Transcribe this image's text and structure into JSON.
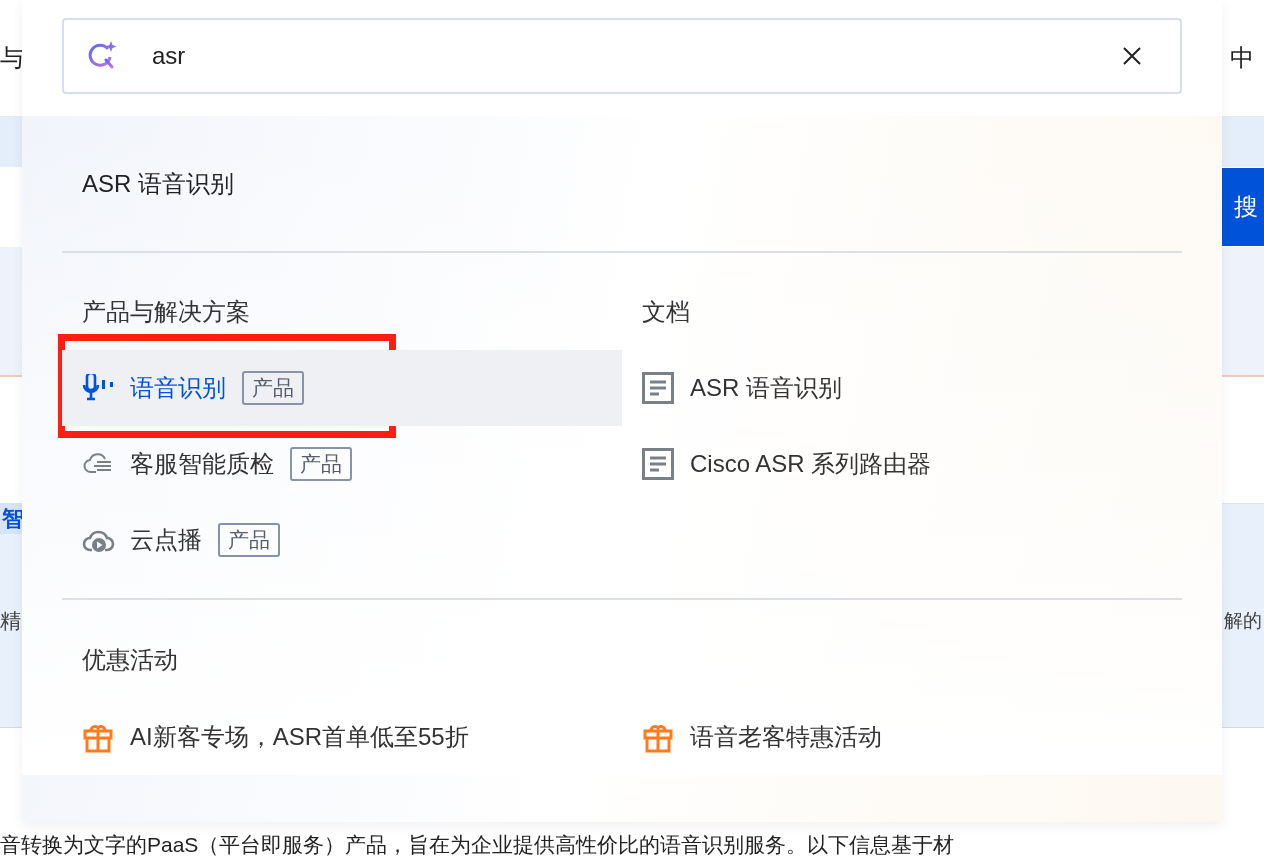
{
  "background": {
    "top_left_text": "与",
    "top_right_text": "中",
    "button_label": "搜",
    "left_label": "智",
    "left_text": "精",
    "right_text": "解的",
    "bottom_text": "音转换为文字的PaaS（平台即服务）产品，旨在为企业提供高性价比的语音识别服务。以下信息基于材"
  },
  "search": {
    "value": "asr"
  },
  "top_suggestion": "ASR 语音识别",
  "products": {
    "title": "产品与解决方案",
    "items": [
      {
        "label": "语音识别",
        "tag": "产品",
        "kind": "mic",
        "selected": true,
        "highlighted": true
      },
      {
        "label": "客服智能质检",
        "tag": "产品",
        "kind": "cloud-lines",
        "selected": false,
        "highlighted": false
      },
      {
        "label": "云点播",
        "tag": "产品",
        "kind": "cloud-play",
        "selected": false,
        "highlighted": false
      }
    ]
  },
  "docs": {
    "title": "文档",
    "items": [
      "ASR 语音识别",
      "Cisco ASR 系列路由器"
    ]
  },
  "promos": {
    "title": "优惠活动",
    "items": [
      "AI新客专场，ASR首单低至55折",
      "语音老客特惠活动"
    ]
  }
}
